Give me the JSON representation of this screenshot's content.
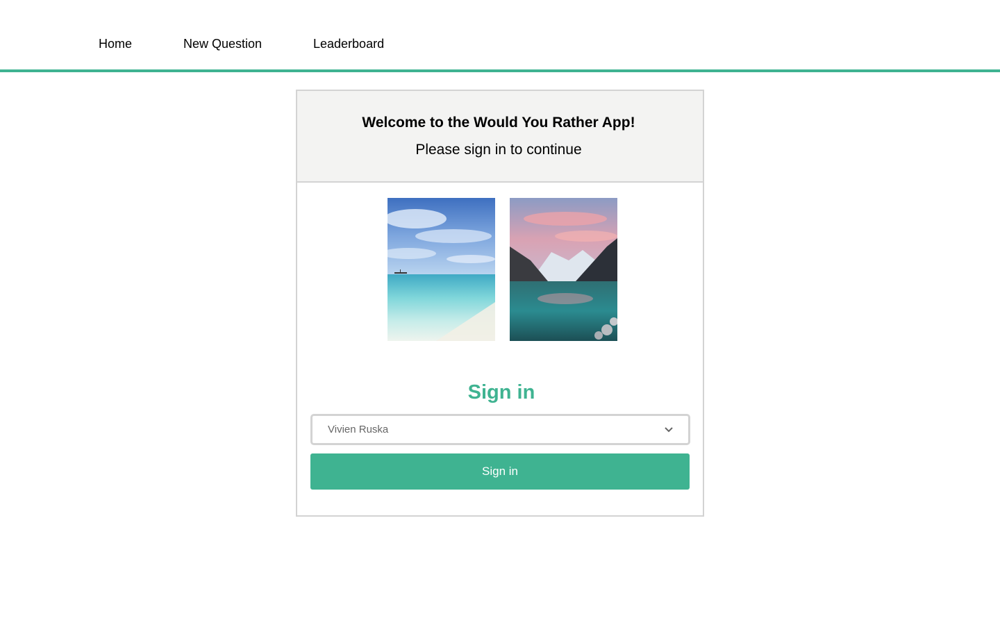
{
  "nav": {
    "items": [
      {
        "label": "Home"
      },
      {
        "label": "New Question"
      },
      {
        "label": "Leaderboard"
      }
    ],
    "accent_color": "#3fb391"
  },
  "card": {
    "welcome": "Welcome to the Would You Rather App!",
    "subtitle": "Please sign in to continue",
    "images": [
      {
        "name": "beach"
      },
      {
        "name": "mountain-lake"
      }
    ],
    "signin_title": "Sign in",
    "user_select": {
      "selected": "Vivien Ruska",
      "icon": "chevron-down-icon"
    },
    "signin_button": "Sign in"
  }
}
